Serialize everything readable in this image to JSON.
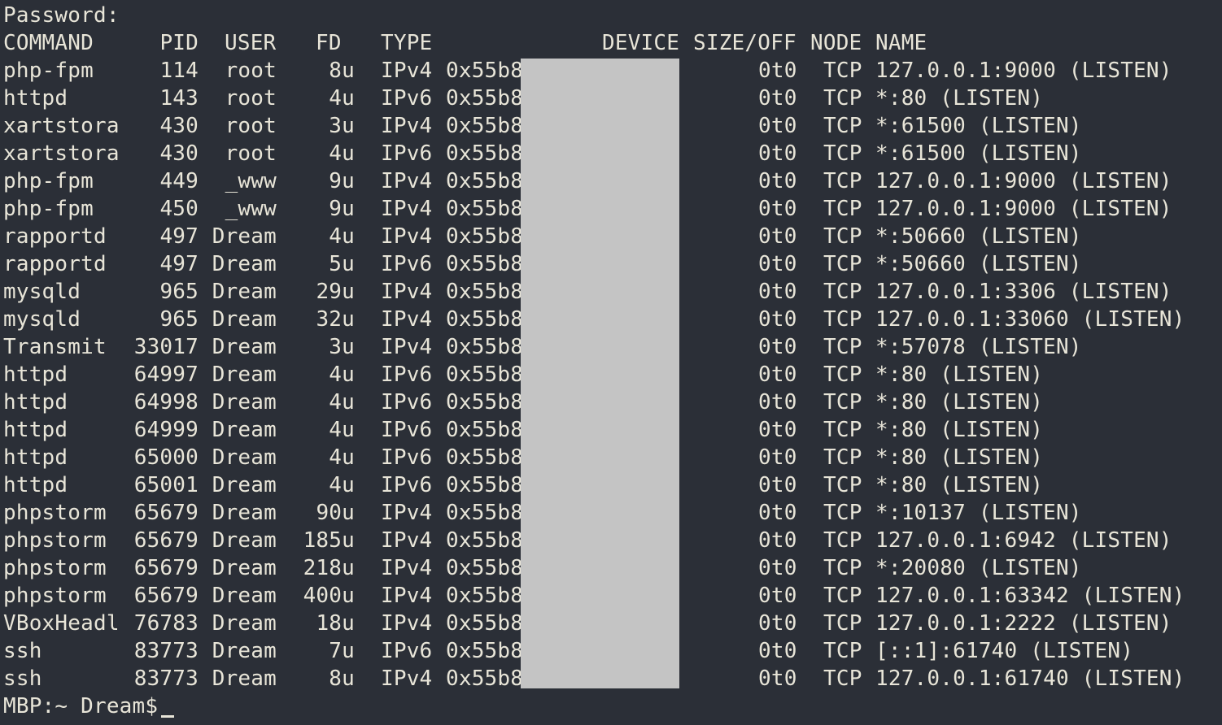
{
  "password_prompt": "Password:",
  "header": {
    "command": "COMMAND",
    "pid": "PID",
    "user": "USER",
    "fd": "FD",
    "type": "TYPE",
    "device": "DEVICE",
    "size_off": "SIZE/OFF",
    "node": "NODE",
    "name": "NAME"
  },
  "rows": [
    {
      "command": "php-fpm",
      "pid": "114",
      "user": "root",
      "fd": "8u",
      "type": "IPv4",
      "device": "0x55b8",
      "size_off": "0t0",
      "node": "TCP",
      "name": "127.0.0.1:9000 (LISTEN)"
    },
    {
      "command": "httpd",
      "pid": "143",
      "user": "root",
      "fd": "4u",
      "type": "IPv6",
      "device": "0x55b8",
      "size_off": "0t0",
      "node": "TCP",
      "name": "*:80 (LISTEN)"
    },
    {
      "command": "xartstora",
      "pid": "430",
      "user": "root",
      "fd": "3u",
      "type": "IPv4",
      "device": "0x55b8",
      "size_off": "0t0",
      "node": "TCP",
      "name": "*:61500 (LISTEN)"
    },
    {
      "command": "xartstora",
      "pid": "430",
      "user": "root",
      "fd": "4u",
      "type": "IPv6",
      "device": "0x55b8",
      "size_off": "0t0",
      "node": "TCP",
      "name": "*:61500 (LISTEN)"
    },
    {
      "command": "php-fpm",
      "pid": "449",
      "user": "_www",
      "fd": "9u",
      "type": "IPv4",
      "device": "0x55b8",
      "size_off": "0t0",
      "node": "TCP",
      "name": "127.0.0.1:9000 (LISTEN)"
    },
    {
      "command": "php-fpm",
      "pid": "450",
      "user": "_www",
      "fd": "9u",
      "type": "IPv4",
      "device": "0x55b8",
      "size_off": "0t0",
      "node": "TCP",
      "name": "127.0.0.1:9000 (LISTEN)"
    },
    {
      "command": "rapportd",
      "pid": "497",
      "user": "Dream",
      "fd": "4u",
      "type": "IPv4",
      "device": "0x55b8",
      "size_off": "0t0",
      "node": "TCP",
      "name": "*:50660 (LISTEN)"
    },
    {
      "command": "rapportd",
      "pid": "497",
      "user": "Dream",
      "fd": "5u",
      "type": "IPv6",
      "device": "0x55b8",
      "size_off": "0t0",
      "node": "TCP",
      "name": "*:50660 (LISTEN)"
    },
    {
      "command": "mysqld",
      "pid": "965",
      "user": "Dream",
      "fd": "29u",
      "type": "IPv4",
      "device": "0x55b8",
      "size_off": "0t0",
      "node": "TCP",
      "name": "127.0.0.1:3306 (LISTEN)"
    },
    {
      "command": "mysqld",
      "pid": "965",
      "user": "Dream",
      "fd": "32u",
      "type": "IPv4",
      "device": "0x55b8",
      "size_off": "0t0",
      "node": "TCP",
      "name": "127.0.0.1:33060 (LISTEN)"
    },
    {
      "command": "Transmit",
      "pid": "33017",
      "user": "Dream",
      "fd": "3u",
      "type": "IPv4",
      "device": "0x55b8",
      "size_off": "0t0",
      "node": "TCP",
      "name": "*:57078 (LISTEN)"
    },
    {
      "command": "httpd",
      "pid": "64997",
      "user": "Dream",
      "fd": "4u",
      "type": "IPv6",
      "device": "0x55b8",
      "size_off": "0t0",
      "node": "TCP",
      "name": "*:80 (LISTEN)"
    },
    {
      "command": "httpd",
      "pid": "64998",
      "user": "Dream",
      "fd": "4u",
      "type": "IPv6",
      "device": "0x55b8",
      "size_off": "0t0",
      "node": "TCP",
      "name": "*:80 (LISTEN)"
    },
    {
      "command": "httpd",
      "pid": "64999",
      "user": "Dream",
      "fd": "4u",
      "type": "IPv6",
      "device": "0x55b8",
      "size_off": "0t0",
      "node": "TCP",
      "name": "*:80 (LISTEN)"
    },
    {
      "command": "httpd",
      "pid": "65000",
      "user": "Dream",
      "fd": "4u",
      "type": "IPv6",
      "device": "0x55b8",
      "size_off": "0t0",
      "node": "TCP",
      "name": "*:80 (LISTEN)"
    },
    {
      "command": "httpd",
      "pid": "65001",
      "user": "Dream",
      "fd": "4u",
      "type": "IPv6",
      "device": "0x55b8",
      "size_off": "0t0",
      "node": "TCP",
      "name": "*:80 (LISTEN)"
    },
    {
      "command": "phpstorm",
      "pid": "65679",
      "user": "Dream",
      "fd": "90u",
      "type": "IPv4",
      "device": "0x55b8",
      "size_off": "0t0",
      "node": "TCP",
      "name": "*:10137 (LISTEN)"
    },
    {
      "command": "phpstorm",
      "pid": "65679",
      "user": "Dream",
      "fd": "185u",
      "type": "IPv4",
      "device": "0x55b8",
      "size_off": "0t0",
      "node": "TCP",
      "name": "127.0.0.1:6942 (LISTEN)"
    },
    {
      "command": "phpstorm",
      "pid": "65679",
      "user": "Dream",
      "fd": "218u",
      "type": "IPv4",
      "device": "0x55b8",
      "size_off": "0t0",
      "node": "TCP",
      "name": "*:20080 (LISTEN)"
    },
    {
      "command": "phpstorm",
      "pid": "65679",
      "user": "Dream",
      "fd": "400u",
      "type": "IPv4",
      "device": "0x55b8",
      "size_off": "0t0",
      "node": "TCP",
      "name": "127.0.0.1:63342 (LISTEN)"
    },
    {
      "command": "VBoxHeadl",
      "pid": "76783",
      "user": "Dream",
      "fd": "18u",
      "type": "IPv4",
      "device": "0x55b8",
      "size_off": "0t0",
      "node": "TCP",
      "name": "127.0.0.1:2222 (LISTEN)"
    },
    {
      "command": "ssh",
      "pid": "83773",
      "user": "Dream",
      "fd": "7u",
      "type": "IPv6",
      "device": "0x55b8",
      "size_off": "0t0",
      "node": "TCP",
      "name": "[::1]:61740 (LISTEN)"
    },
    {
      "command": "ssh",
      "pid": "83773",
      "user": "Dream",
      "fd": "8u",
      "type": "IPv4",
      "device": "0x55b8",
      "size_off": "0t0",
      "node": "TCP",
      "name": "127.0.0.1:61740 (LISTEN)"
    }
  ],
  "prompt": "MBP:~ Dream$",
  "colors": {
    "background": "#2b2f37",
    "foreground": "#e8e5d8",
    "redaction": "#c4c4c4"
  }
}
